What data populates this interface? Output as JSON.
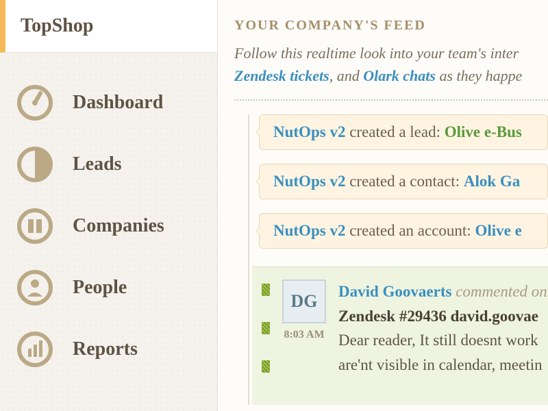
{
  "brand": "TopShop",
  "sidebar": {
    "items": [
      {
        "label": "Dashboard"
      },
      {
        "label": "Leads"
      },
      {
        "label": "Companies"
      },
      {
        "label": "People"
      },
      {
        "label": "Reports"
      }
    ]
  },
  "feed": {
    "title": "YOUR COMPANY'S FEED",
    "subtitle_lead": "Follow this realtime look into your team's inter",
    "subtitle_link1": "Zendesk tickets",
    "subtitle_mid": ", and ",
    "subtitle_link2": "Olark chats",
    "subtitle_tail": " as they happe"
  },
  "events": [
    {
      "actor": "NutOps v2",
      "action": " created a lead: ",
      "object": "Olive e-Bus",
      "object_color": "green"
    },
    {
      "actor": "NutOps v2",
      "action": " created a contact: ",
      "object": "Alok Ga",
      "object_color": "blue"
    },
    {
      "actor": "NutOps v2",
      "action": " created an account: ",
      "object": "Olive e",
      "object_color": "blue"
    }
  ],
  "comment": {
    "initials": "DG",
    "time": "8:03 AM",
    "author": "David Goovaerts",
    "meta": " commented on",
    "ticket": "Zendesk #29436 david.goovae",
    "body_line1": "Dear reader, It still doesnt work ",
    "body_line2": "are'nt visible in calendar, meetin"
  }
}
